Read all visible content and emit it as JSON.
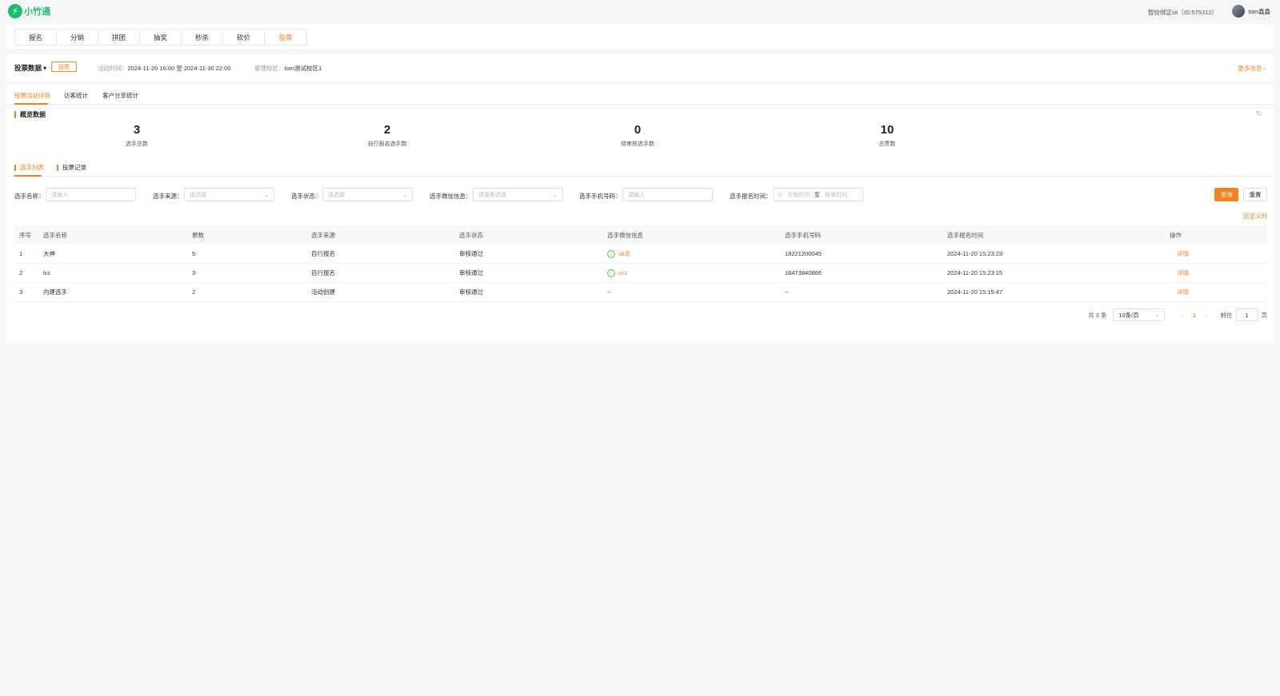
{
  "header": {
    "logo_mark": "⚡",
    "logo_text": "小竹通",
    "org": "智校绑定sit（ID:575312）",
    "user_name": "tom鑫鑫"
  },
  "modules": [
    "报名",
    "分销",
    "拼团",
    "抽奖",
    "秒杀",
    "砍价",
    "投票"
  ],
  "active_module": "投票",
  "activity": {
    "title": "投票数据",
    "badge": "投票",
    "time_label": "活动时间：",
    "time_value": "2024-11-20 16:00 至 2024-11-30 22:00",
    "campus_label": "管理校区：",
    "campus_value": "tom测试校区1",
    "more": "更多信息 ›"
  },
  "subtabs": [
    "投票活动详情",
    "访客统计",
    "客户分享统计"
  ],
  "overview": {
    "title": "概览数据",
    "stats": [
      {
        "value": "3",
        "label": "选手总数"
      },
      {
        "value": "2",
        "label": "自行报名选手数"
      },
      {
        "value": "0",
        "label": "待审核选手数"
      },
      {
        "value": "10",
        "label": "总票数"
      }
    ]
  },
  "list_tabs": [
    "选手列表",
    "投票记录"
  ],
  "filters": {
    "name_label": "选手名称：",
    "name_placeholder": "请输入",
    "source_label": "选手来源：",
    "source_placeholder": "请选择",
    "status_label": "选手状态：",
    "status_placeholder": "请选择",
    "wechat_label": "选手微信信息：",
    "wechat_placeholder": "请搜索选择",
    "phone_label": "选手手机号码：",
    "phone_placeholder": "请输入",
    "time_label": "选手报名时间：",
    "start_placeholder": "开始时间",
    "range_sep": "至",
    "end_placeholder": "结束时间",
    "query": "查询",
    "reset": "重置",
    "custom_columns": "自定义列"
  },
  "table": {
    "columns": [
      "序号",
      "选手名称",
      "票数",
      "选手来源",
      "选手状态",
      "选手微信信息",
      "选手手机号码",
      "选手报名时间",
      "操作"
    ],
    "rows": [
      {
        "no": "1",
        "name": "大神",
        "votes": "5",
        "source": "自行报名",
        "status": "审核通过",
        "wechat": "sit龙",
        "phone": "18221200045",
        "time": "2024-11-20 15:23:23",
        "op": "详情"
      },
      {
        "no": "2",
        "name": "lcc",
        "votes": "3",
        "source": "自行报名",
        "status": "审核通过",
        "wechat": "cc1",
        "phone": "18473840866",
        "time": "2024-11-20 15:23:15",
        "op": "详情"
      },
      {
        "no": "3",
        "name": "内建选手",
        "votes": "2",
        "source": "活动创建",
        "status": "审核通过",
        "wechat": "--",
        "phone": "--",
        "time": "2024-11-20 15:15:47",
        "op": "详情"
      }
    ]
  },
  "pagination": {
    "total": "共 3 条",
    "page_size": "10条/页",
    "current": "1",
    "goto_label": "前往",
    "goto_value": "1",
    "page_unit": "页"
  },
  "colors": {
    "accent": "#f4811f",
    "brand": "#1bbf6b"
  }
}
